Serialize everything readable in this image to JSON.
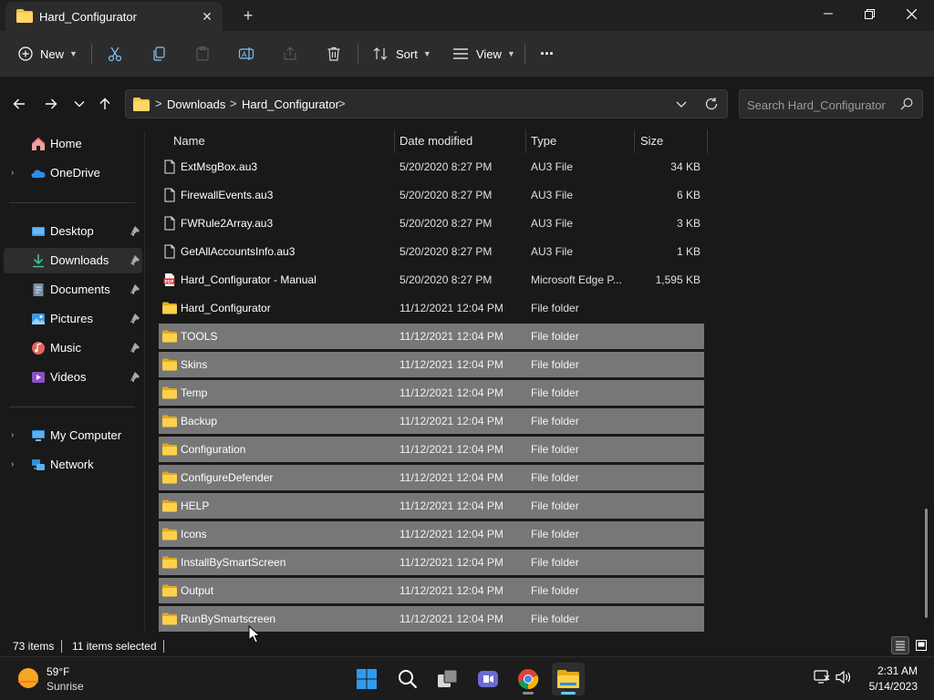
{
  "window": {
    "tab_title": "Hard_Configurator",
    "new_tab_symbol": "+"
  },
  "commandbar": {
    "new_label": "New",
    "sort_label": "Sort",
    "view_label": "View",
    "more_symbol": "..."
  },
  "address": {
    "crumbs": [
      "Downloads",
      "Hard_Configurator"
    ],
    "separator": ">"
  },
  "search": {
    "placeholder": "Search Hard_Configurator"
  },
  "sidebar": {
    "items": [
      {
        "label": "Home",
        "icon": "home-icon"
      },
      {
        "label": "OneDrive",
        "icon": "onedrive-icon"
      },
      {
        "label": "Desktop",
        "icon": "desktop-icon",
        "pinned": true
      },
      {
        "label": "Downloads",
        "icon": "downloads-icon",
        "pinned": true,
        "active": true
      },
      {
        "label": "Documents",
        "icon": "documents-icon",
        "pinned": true
      },
      {
        "label": "Pictures",
        "icon": "pictures-icon",
        "pinned": true
      },
      {
        "label": "Music",
        "icon": "music-icon",
        "pinned": true
      },
      {
        "label": "Videos",
        "icon": "videos-icon",
        "pinned": true
      },
      {
        "label": "My Computer",
        "icon": "computer-icon"
      },
      {
        "label": "Network",
        "icon": "network-icon"
      }
    ]
  },
  "columns": {
    "name": "Name",
    "date": "Date modified",
    "type": "Type",
    "size": "Size"
  },
  "files": [
    {
      "name": "ExtMsgBox.au3",
      "date": "5/20/2020 8:27 PM",
      "type": "AU3 File",
      "size": "34 KB",
      "icon": "file-icon",
      "selected": false
    },
    {
      "name": "FirewallEvents.au3",
      "date": "5/20/2020 8:27 PM",
      "type": "AU3 File",
      "size": "6 KB",
      "icon": "file-icon",
      "selected": false
    },
    {
      "name": "FWRule2Array.au3",
      "date": "5/20/2020 8:27 PM",
      "type": "AU3 File",
      "size": "3 KB",
      "icon": "file-icon",
      "selected": false
    },
    {
      "name": "GetAllAccountsInfo.au3",
      "date": "5/20/2020 8:27 PM",
      "type": "AU3 File",
      "size": "1 KB",
      "icon": "file-icon",
      "selected": false
    },
    {
      "name": "Hard_Configurator - Manual",
      "date": "5/20/2020 8:27 PM",
      "type": "Microsoft Edge P...",
      "size": "1,595 KB",
      "icon": "pdf-icon",
      "selected": false
    },
    {
      "name": "Hard_Configurator",
      "date": "11/12/2021 12:04 PM",
      "type": "File folder",
      "size": "",
      "icon": "folder-icon",
      "selected": false
    },
    {
      "name": "TOOLS",
      "date": "11/12/2021 12:04 PM",
      "type": "File folder",
      "size": "",
      "icon": "folder-icon",
      "selected": true
    },
    {
      "name": "Skins",
      "date": "11/12/2021 12:04 PM",
      "type": "File folder",
      "size": "",
      "icon": "folder-icon",
      "selected": true
    },
    {
      "name": "Temp",
      "date": "11/12/2021 12:04 PM",
      "type": "File folder",
      "size": "",
      "icon": "folder-icon",
      "selected": true
    },
    {
      "name": "Backup",
      "date": "11/12/2021 12:04 PM",
      "type": "File folder",
      "size": "",
      "icon": "folder-icon",
      "selected": true
    },
    {
      "name": "Configuration",
      "date": "11/12/2021 12:04 PM",
      "type": "File folder",
      "size": "",
      "icon": "folder-icon",
      "selected": true
    },
    {
      "name": "ConfigureDefender",
      "date": "11/12/2021 12:04 PM",
      "type": "File folder",
      "size": "",
      "icon": "folder-icon",
      "selected": true
    },
    {
      "name": "HELP",
      "date": "11/12/2021 12:04 PM",
      "type": "File folder",
      "size": "",
      "icon": "folder-icon",
      "selected": true
    },
    {
      "name": "Icons",
      "date": "11/12/2021 12:04 PM",
      "type": "File folder",
      "size": "",
      "icon": "folder-icon",
      "selected": true
    },
    {
      "name": "InstallBySmartScreen",
      "date": "11/12/2021 12:04 PM",
      "type": "File folder",
      "size": "",
      "icon": "folder-icon",
      "selected": true
    },
    {
      "name": "Output",
      "date": "11/12/2021 12:04 PM",
      "type": "File folder",
      "size": "",
      "icon": "folder-icon",
      "selected": true
    },
    {
      "name": "RunBySmartscreen",
      "date": "11/12/2021 12:04 PM",
      "type": "File folder",
      "size": "",
      "icon": "folder-icon",
      "selected": true
    }
  ],
  "status": {
    "item_count": "73 items",
    "selected_count": "11 items selected"
  },
  "taskbar": {
    "weather_temp": "59°F",
    "weather_condition": "Sunrise",
    "time": "2:31 AM",
    "date": "5/14/2023",
    "apps": [
      "start-icon",
      "search-icon",
      "task-view-icon",
      "teams-chat-icon",
      "chrome-icon",
      "file-explorer-icon"
    ]
  },
  "colors": {
    "selection": "#777777",
    "folder": "#f4c545",
    "accent": "#60cdff"
  }
}
